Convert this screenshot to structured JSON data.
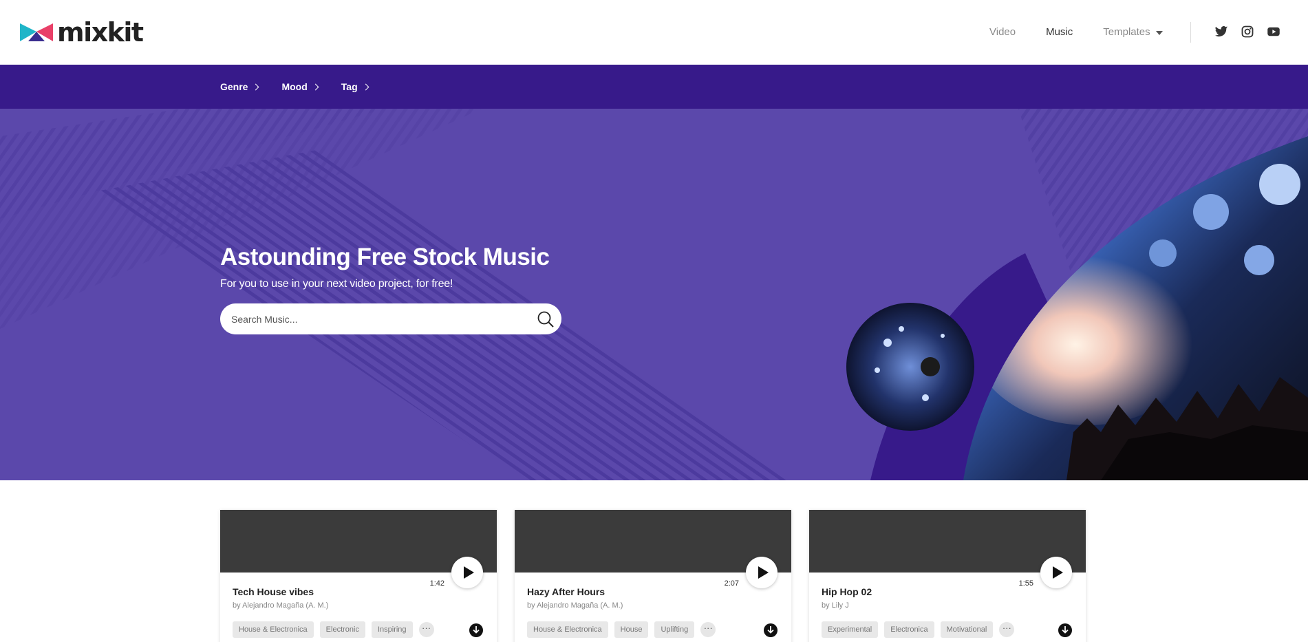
{
  "header": {
    "logo_text": "mixkit",
    "nav": [
      {
        "label": "Video",
        "active": false
      },
      {
        "label": "Music",
        "active": true
      },
      {
        "label": "Templates",
        "active": false,
        "has_dropdown": true
      }
    ],
    "social_icons": [
      "twitter-icon",
      "instagram-icon",
      "youtube-icon"
    ]
  },
  "subnav": {
    "items": [
      {
        "label": "Genre"
      },
      {
        "label": "Mood"
      },
      {
        "label": "Tag"
      }
    ]
  },
  "hero": {
    "title": "Astounding Free Stock Music",
    "subtitle": "For you to use in your next video project, for free!",
    "search": {
      "placeholder": "Search Music...",
      "value": ""
    }
  },
  "tracks": [
    {
      "title": "Tech House vibes",
      "author": "by Alejandro Magaña (A. M.)",
      "duration": "1:42",
      "tags": [
        "House & Electronica",
        "Electronic",
        "Inspiring"
      ]
    },
    {
      "title": "Hazy After Hours",
      "author": "by Alejandro Magaña (A. M.)",
      "duration": "2:07",
      "tags": [
        "House & Electronica",
        "House",
        "Uplifting"
      ]
    },
    {
      "title": "Hip Hop 02",
      "author": "by Lily J",
      "duration": "1:55",
      "tags": [
        "Experimental",
        "Electronica",
        "Motivational"
      ]
    }
  ],
  "colors": {
    "subnav_bg": "#371a8a",
    "hero_bg": "#5b48ab",
    "hero_shape": "#371a8a",
    "card_thumb": "#3b3b3b"
  }
}
